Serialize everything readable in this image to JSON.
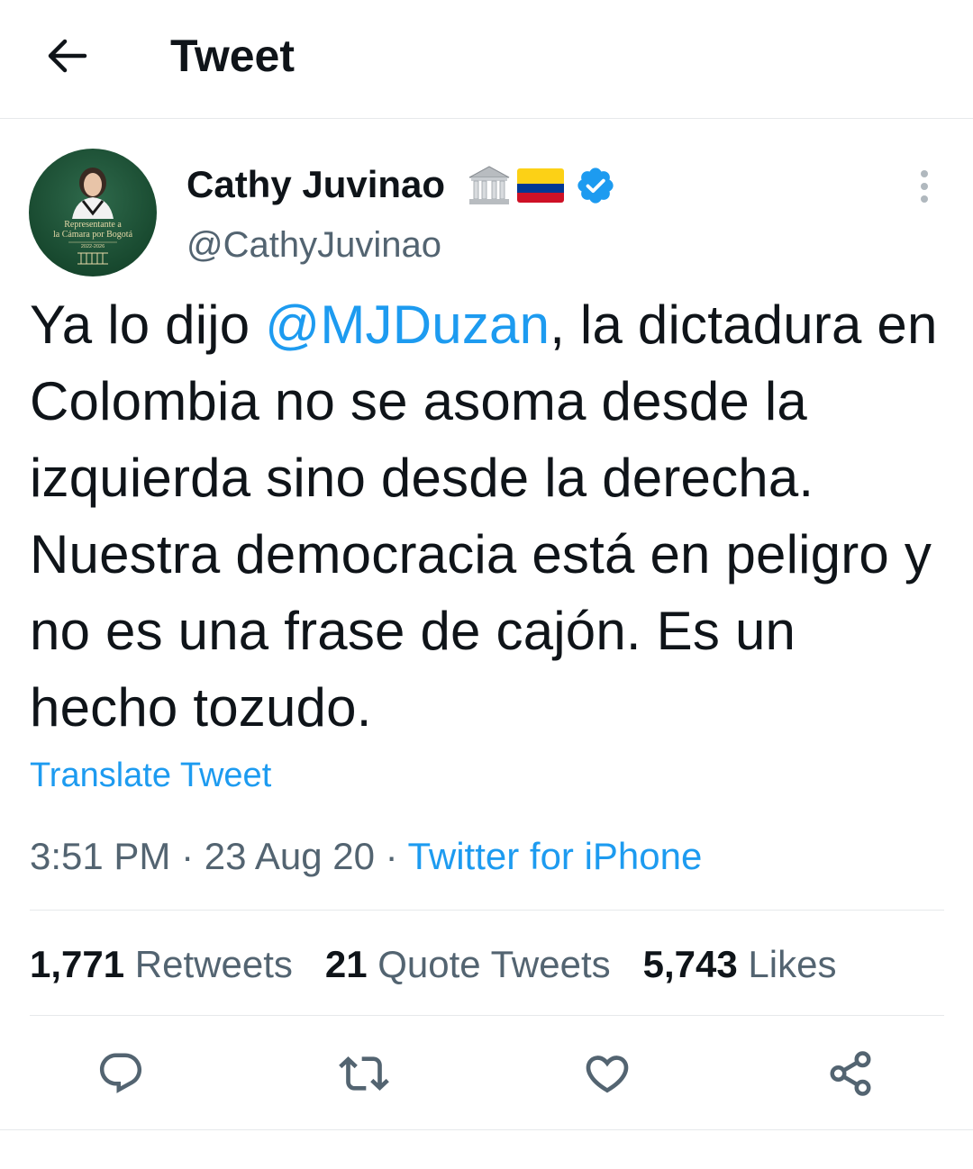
{
  "header": {
    "title": "Tweet",
    "back_icon": "arrow-left-icon"
  },
  "author": {
    "display_name": "Cathy Juvinao",
    "handle": "@CathyJuvinao",
    "name_emojis": [
      "classical-building-emoji",
      "colombia-flag-emoji"
    ],
    "verified": true,
    "avatar_text": {
      "line1": "Representante a",
      "line2": "la Cámara por Bogotá",
      "line3": "2022-2026"
    }
  },
  "tweet": {
    "text_before": "Ya lo dijo ",
    "mention": "@MJDuzan",
    "text_after": ", la dictadura en Colombia no se asoma desde la izquierda sino desde la derecha. Nuestra democracia está en peligro y no es una frase de cajón. Es un hecho tozudo.",
    "translate_label": "Translate Tweet",
    "time": "3:51 PM",
    "date": "23 Aug 20",
    "separator": "·",
    "source": "Twitter for iPhone"
  },
  "stats": {
    "retweets_count": "1,771",
    "retweets_label": "Retweets",
    "quotes_count": "21",
    "quotes_label": "Quote Tweets",
    "likes_count": "5,743",
    "likes_label": "Likes"
  },
  "actions": [
    "reply-icon",
    "retweet-icon",
    "like-icon",
    "share-icon"
  ],
  "colors": {
    "accent": "#1d9bf0",
    "text_primary": "#0f1419",
    "text_secondary": "#536471",
    "divider": "#e6e9eb",
    "avatar_green": "#18492f"
  }
}
